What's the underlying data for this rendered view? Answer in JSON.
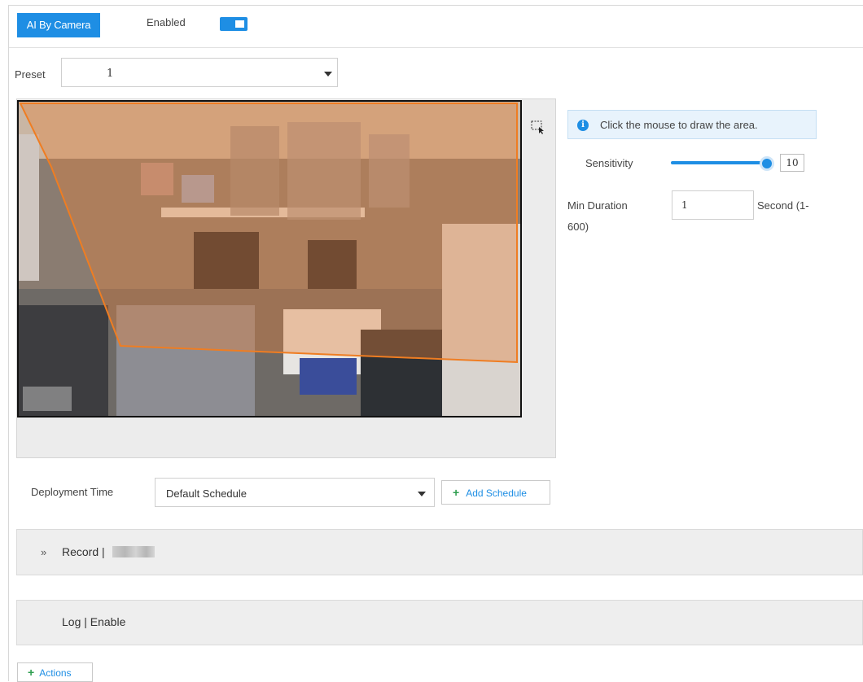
{
  "header": {
    "ai_button_label": "AI By Camera",
    "enabled_label": "Enabled",
    "enabled_toggle_on": true
  },
  "preset": {
    "label": "Preset",
    "value": "1"
  },
  "video": {
    "overlay_color": "#e8823a"
  },
  "rule_panel": {
    "info_text": "Click the mouse to draw the area.",
    "sensitivity_label": "Sensitivity",
    "sensitivity_value": "10",
    "min_duration_label": "Min Duration",
    "min_duration_value": "1",
    "min_duration_unit_line1": "Second (1-",
    "min_duration_unit_line2": "600)"
  },
  "deployment": {
    "label": "Deployment Time",
    "schedule_value": "Default Schedule",
    "add_schedule_label": "Add Schedule"
  },
  "panels": {
    "record_title": "Record |",
    "log_title": "Log | Enable"
  },
  "actions_label": "Actions",
  "colors": {
    "accent": "#1e8ee4",
    "plus_green": "#2e9e4f"
  }
}
